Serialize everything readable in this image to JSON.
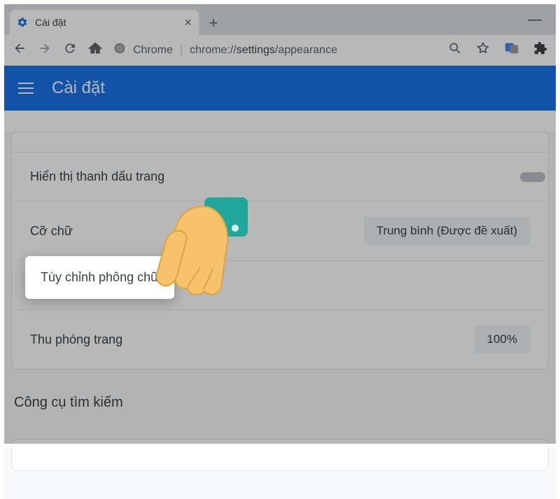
{
  "tab": {
    "title": "Cài đặt"
  },
  "omnibox": {
    "scheme_label": "Chrome",
    "url_prefix": "chrome://",
    "url_bold": "settings",
    "url_suffix": "/appearance"
  },
  "settings_header": {
    "title": "Cài đặt"
  },
  "rows": {
    "bookmarks_bar": "Hiển thị thanh dấu trang",
    "font_size": {
      "label": "Cỡ chữ",
      "value": "Trung bình (Được đề xuất)"
    },
    "custom_fonts": "Tùy chỉnh phông chữ",
    "page_zoom": {
      "label": "Thu phóng trang",
      "value": "100%"
    }
  },
  "search_engine_section": "Công cụ tìm kiếm"
}
